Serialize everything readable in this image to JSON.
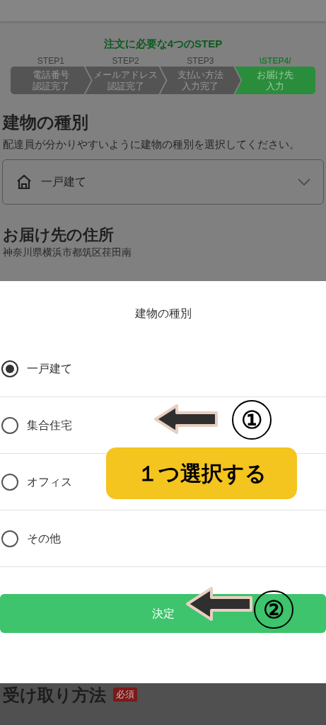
{
  "steps_title": "注文に必要な4つのSTEP",
  "steps": [
    {
      "label": "STEP1",
      "lines": [
        "電話番号",
        "認証完了"
      ],
      "selected": false
    },
    {
      "label": "STEP2",
      "lines": [
        "メールアドレス",
        "認証完了"
      ],
      "selected": false
    },
    {
      "label": "STEP3",
      "lines": [
        "支払い方法",
        "入力完了"
      ],
      "selected": false
    },
    {
      "label": "\\STEP4/",
      "lines": [
        "お届け先",
        "入力"
      ],
      "selected": true
    }
  ],
  "building_section": {
    "heading": "建物の種別",
    "description": "配達員が分かりやすいように建物の種別を選択してください。",
    "select": {
      "value": "一戸建て"
    }
  },
  "address_section": {
    "heading": "お届け先の住所",
    "address": "神奈川県横浜市都筑区荏田南"
  },
  "sheet": {
    "title": "建物の種別",
    "options": [
      {
        "label": "一戸建て",
        "selected": true
      },
      {
        "label": "集合住宅",
        "selected": false
      },
      {
        "label": "オフィス",
        "selected": false
      },
      {
        "label": "その他",
        "selected": false
      }
    ],
    "confirm_button": "決定"
  },
  "annotations": {
    "marker_1": "①",
    "callout": "１つ選択する",
    "marker_2": "②"
  },
  "receive_section": {
    "heading": "受け取り方法",
    "badge": "必須"
  }
}
